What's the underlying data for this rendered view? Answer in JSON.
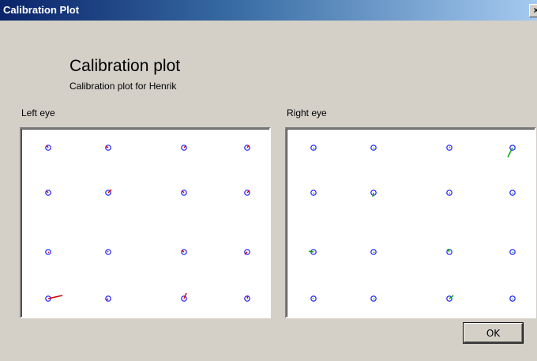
{
  "window": {
    "title": "Calibration Plot",
    "close_label": "×"
  },
  "header": {
    "title": "Calibration plot",
    "subtitle": "Calibration plot for Henrik"
  },
  "panels": [
    {
      "label": "Left eye",
      "circle_color": "#1a1aff",
      "gaze_color": "#dd0000"
    },
    {
      "label": "Right eye",
      "circle_color": "#1a1aff",
      "gaze_color": "#00aa00"
    }
  ],
  "calibration": {
    "grid_cols": 4,
    "grid_rows": 4,
    "points": [
      {
        "col": 0,
        "row": 0
      },
      {
        "col": 1,
        "row": 0
      },
      {
        "col": 2,
        "row": 0
      },
      {
        "col": 3,
        "row": 0
      },
      {
        "col": 0,
        "row": 1
      },
      {
        "col": 1,
        "row": 1
      },
      {
        "col": 2,
        "row": 1
      },
      {
        "col": 3,
        "row": 1
      },
      {
        "col": 0,
        "row": 2
      },
      {
        "col": 1,
        "row": 2
      },
      {
        "col": 2,
        "row": 2
      },
      {
        "col": 3,
        "row": 2
      },
      {
        "col": 0,
        "row": 3
      },
      {
        "col": 1,
        "row": 3
      },
      {
        "col": 2,
        "row": 3
      },
      {
        "col": 3,
        "row": 3
      }
    ]
  },
  "buttons": {
    "ok_label": "OK"
  }
}
